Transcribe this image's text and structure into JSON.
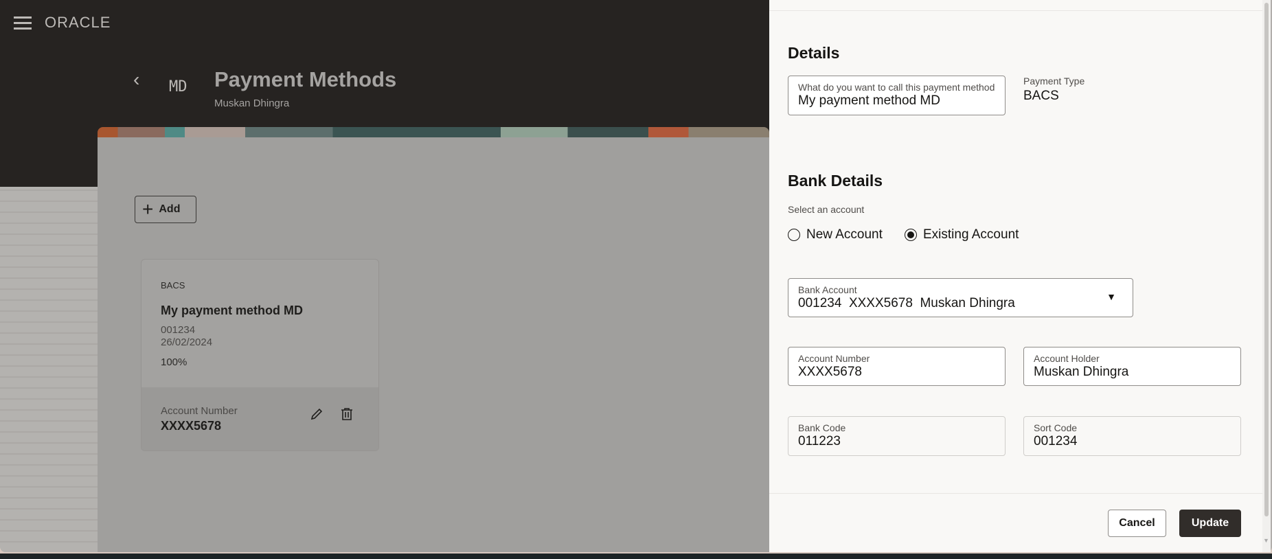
{
  "header": {
    "logo": "ORACLE",
    "back_icon": "‹",
    "avatar_initials": "MD",
    "title": "Payment Methods",
    "subtitle": "Muskan Dhingra"
  },
  "page": {
    "add_label": "Add"
  },
  "card": {
    "type": "BACS",
    "name": "My payment method MD",
    "line1": "001234",
    "line2": "26/02/2024",
    "percentage": "100%",
    "account_label": "Account Number",
    "account_value": "XXXX5678"
  },
  "panel": {
    "details_heading": "Details",
    "name_field": {
      "label": "What do you want to call this payment method?.",
      "value": "My payment method MD"
    },
    "payment_type": {
      "label": "Payment Type",
      "value": "BACS"
    },
    "bank_heading": "Bank Details",
    "select_account_label": "Select an account",
    "radio_new": "New Account",
    "radio_existing": "Existing Account",
    "selected_radio": "Existing Account",
    "bank_account": {
      "label": "Bank Account",
      "value": "001234  XXXX5678  Muskan Dhingra"
    },
    "account_number": {
      "label": "Account Number",
      "value": "XXXX5678"
    },
    "account_holder": {
      "label": "Account Holder",
      "value": "Muskan Dhingra"
    },
    "bank_code": {
      "label": "Bank Code",
      "value": "011223"
    },
    "sort_code": {
      "label": "Sort Code",
      "value": "001234"
    },
    "cancel_label": "Cancel",
    "update_label": "Update"
  }
}
